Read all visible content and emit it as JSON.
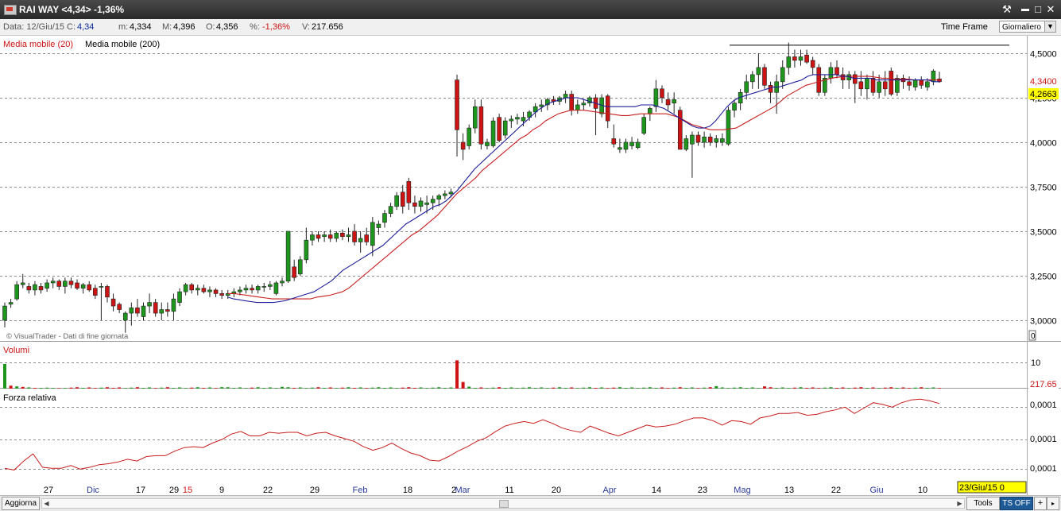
{
  "window": {
    "title": "RAI WAY <4,34> -1,36%",
    "buttons": {
      "tool": "⚒",
      "minimize": "▬",
      "maximize": "□",
      "close": "✕"
    }
  },
  "infobar": {
    "data": "Data: 12/Giu/15",
    "close_label": "C:",
    "close_value": "4,34",
    "min_label": "m:",
    "min_value": "4,334",
    "max_label": "M:",
    "max_value": "4,396",
    "open_label": "O:",
    "open_value": "4,356",
    "pct_label": "%:",
    "pct_value": "-1,36%",
    "vol_label": "V:",
    "vol_value": "217.656",
    "timeframe_label": "Time Frame",
    "timeframe_value": "Giornaliero"
  },
  "legend": {
    "ma20": "Media mobile (20)",
    "ma200": "Media mobile (200)",
    "watermark": "© VisualTrader - Dati di fine giornata",
    "volumes": "Volumi",
    "rsi": "Forza relativa"
  },
  "right_labels": {
    "last_price": "4,3400",
    "ma_price": "4,2663",
    "main_zero": "0",
    "volume_tick": "10",
    "volume_last": "217.65",
    "rsi_ticks": [
      "0,0001",
      "0,0001",
      "0,0001"
    ]
  },
  "date_box": "23/Giu/15 0",
  "bottombar": {
    "aggiorna": "Aggiorna",
    "tools": "Tools",
    "tsoff": "TS OFF",
    "plus": "+",
    "more": "▸"
  },
  "colors": {
    "up": "#1e961e",
    "down": "#cc1414",
    "ma20": "#c81e1e",
    "ma200": "#1e1e9b",
    "rsi": "#c81e1e",
    "grid": "#8c8c8c",
    "price_box": "#ffff00"
  },
  "chart_data": {
    "type": "candlestick",
    "price_axis": {
      "ticks": [
        "3,0000",
        "3,2500",
        "3,5000",
        "3,7500",
        "4,0000",
        "4,2500",
        "4,5000"
      ],
      "values": [
        3.0,
        3.25,
        3.5,
        3.75,
        4.0,
        4.25,
        4.5
      ],
      "range": [
        2.88,
        4.55
      ]
    },
    "x_axis_labels": [
      "27",
      "Dic",
      "17",
      "29",
      "15",
      "9",
      "22",
      "29",
      "Feb",
      "18",
      "2",
      "Mar",
      "11",
      "20",
      "Apr",
      "14",
      "23",
      "Mag",
      "13",
      "22",
      "Giu",
      "10"
    ],
    "resistance_level": 4.545,
    "ohlc": [
      [
        3.0,
        3.1,
        2.96,
        3.08
      ],
      [
        3.09,
        3.12,
        3.07,
        3.1
      ],
      [
        3.12,
        3.22,
        3.11,
        3.2
      ],
      [
        3.2,
        3.26,
        3.18,
        3.21
      ],
      [
        3.19,
        3.21,
        3.15,
        3.17
      ],
      [
        3.17,
        3.22,
        3.14,
        3.2
      ],
      [
        3.19,
        3.21,
        3.15,
        3.17
      ],
      [
        3.18,
        3.23,
        3.16,
        3.21
      ],
      [
        3.21,
        3.24,
        3.18,
        3.22
      ],
      [
        3.22,
        3.23,
        3.17,
        3.19
      ],
      [
        3.19,
        3.24,
        3.15,
        3.22
      ],
      [
        3.22,
        3.24,
        3.18,
        3.2
      ],
      [
        3.21,
        3.23,
        3.17,
        3.18
      ],
      [
        3.18,
        3.21,
        3.15,
        3.2
      ],
      [
        3.2,
        3.22,
        3.16,
        3.17
      ],
      [
        3.18,
        3.2,
        3.12,
        3.14
      ],
      [
        3.19,
        3.21,
        3.0,
        3.19
      ],
      [
        3.19,
        3.2,
        3.1,
        3.13
      ],
      [
        3.12,
        3.15,
        3.05,
        3.08
      ],
      [
        3.09,
        3.1,
        3.04,
        3.06
      ],
      [
        3.0,
        3.05,
        2.93,
        3.04
      ],
      [
        3.04,
        3.1,
        2.97,
        3.07
      ],
      [
        3.07,
        3.12,
        3.02,
        3.04
      ],
      [
        3.02,
        3.1,
        3.0,
        3.08
      ],
      [
        3.08,
        3.15,
        3.04,
        3.1
      ],
      [
        3.1,
        3.12,
        3.02,
        3.04
      ],
      [
        3.04,
        3.1,
        3.0,
        3.06
      ],
      [
        3.06,
        3.1,
        3.02,
        3.05
      ],
      [
        3.05,
        3.15,
        3.0,
        3.12
      ],
      [
        3.1,
        3.18,
        3.08,
        3.16
      ],
      [
        3.16,
        3.21,
        3.14,
        3.2
      ],
      [
        3.2,
        3.21,
        3.15,
        3.17
      ],
      [
        3.17,
        3.2,
        3.14,
        3.18
      ],
      [
        3.18,
        3.2,
        3.15,
        3.16
      ],
      [
        3.16,
        3.19,
        3.13,
        3.17
      ],
      [
        3.17,
        3.18,
        3.13,
        3.15
      ],
      [
        3.15,
        3.17,
        3.12,
        3.14
      ],
      [
        3.14,
        3.17,
        3.12,
        3.15
      ],
      [
        3.15,
        3.18,
        3.13,
        3.16
      ],
      [
        3.16,
        3.19,
        3.14,
        3.17
      ],
      [
        3.17,
        3.2,
        3.15,
        3.18
      ],
      [
        3.18,
        3.2,
        3.15,
        3.17
      ],
      [
        3.17,
        3.2,
        3.15,
        3.19
      ],
      [
        3.19,
        3.21,
        3.16,
        3.19
      ],
      [
        3.19,
        3.22,
        3.17,
        3.2
      ],
      [
        3.15,
        3.22,
        3.14,
        3.21
      ],
      [
        3.21,
        3.24,
        3.19,
        3.22
      ],
      [
        3.22,
        3.5,
        3.21,
        3.5
      ],
      [
        3.3,
        3.34,
        3.22,
        3.24
      ],
      [
        3.26,
        3.36,
        3.25,
        3.34
      ],
      [
        3.34,
        3.52,
        3.32,
        3.45
      ],
      [
        3.45,
        3.5,
        3.42,
        3.48
      ],
      [
        3.48,
        3.5,
        3.44,
        3.46
      ],
      [
        3.47,
        3.5,
        3.44,
        3.48
      ],
      [
        3.48,
        3.51,
        3.44,
        3.46
      ],
      [
        3.46,
        3.5,
        3.44,
        3.49
      ],
      [
        3.49,
        3.51,
        3.45,
        3.47
      ],
      [
        3.47,
        3.52,
        3.44,
        3.48
      ],
      [
        3.5,
        3.54,
        3.42,
        3.44
      ],
      [
        3.44,
        3.5,
        3.38,
        3.46
      ],
      [
        3.48,
        3.52,
        3.42,
        3.44
      ],
      [
        3.42,
        3.58,
        3.36,
        3.55
      ],
      [
        3.52,
        3.56,
        3.48,
        3.54
      ],
      [
        3.55,
        3.62,
        3.52,
        3.6
      ],
      [
        3.6,
        3.66,
        3.58,
        3.64
      ],
      [
        3.64,
        3.72,
        3.62,
        3.7
      ],
      [
        3.72,
        3.76,
        3.6,
        3.64
      ],
      [
        3.78,
        3.8,
        3.62,
        3.66
      ],
      [
        3.66,
        3.7,
        3.6,
        3.64
      ],
      [
        3.64,
        3.69,
        3.61,
        3.67
      ],
      [
        3.65,
        3.7,
        3.6,
        3.66
      ],
      [
        3.66,
        3.7,
        3.62,
        3.68
      ],
      [
        3.68,
        3.71,
        3.64,
        3.7
      ],
      [
        3.7,
        3.73,
        3.68,
        3.71
      ],
      [
        3.71,
        3.74,
        3.69,
        3.72
      ],
      [
        4.35,
        4.38,
        3.92,
        4.07
      ],
      [
        4.0,
        4.05,
        3.9,
        3.96
      ],
      [
        3.98,
        4.1,
        3.96,
        4.08
      ],
      [
        4.08,
        4.24,
        4.05,
        4.2
      ],
      [
        4.2,
        4.24,
        3.96,
        3.99
      ],
      [
        3.98,
        4.02,
        3.96,
        4.0
      ],
      [
        3.98,
        4.14,
        3.97,
        4.12
      ],
      [
        4.14,
        4.16,
        4.0,
        4.01
      ],
      [
        4.04,
        4.14,
        4.02,
        4.12
      ],
      [
        4.12,
        4.15,
        4.08,
        4.13
      ],
      [
        4.13,
        4.16,
        4.1,
        4.14
      ],
      [
        4.12,
        4.17,
        4.09,
        4.14
      ],
      [
        4.14,
        4.18,
        4.12,
        4.17
      ],
      [
        4.17,
        4.22,
        4.14,
        4.2
      ],
      [
        4.2,
        4.24,
        4.17,
        4.21
      ],
      [
        4.21,
        4.25,
        4.18,
        4.24
      ],
      [
        4.24,
        4.26,
        4.21,
        4.23
      ],
      [
        4.23,
        4.26,
        4.21,
        4.25
      ],
      [
        4.25,
        4.29,
        4.22,
        4.27
      ],
      [
        4.27,
        4.29,
        4.15,
        4.18
      ],
      [
        4.18,
        4.24,
        4.16,
        4.21
      ],
      [
        4.21,
        4.24,
        4.18,
        4.22
      ],
      [
        4.22,
        4.26,
        4.2,
        4.25
      ],
      [
        4.25,
        4.27,
        4.04,
        4.19
      ],
      [
        4.16,
        4.27,
        4.14,
        4.25
      ],
      [
        4.26,
        4.27,
        4.08,
        4.12
      ],
      [
        4.02,
        4.1,
        3.97,
        3.99
      ],
      [
        3.96,
        4.02,
        3.94,
        3.97
      ],
      [
        3.96,
        4.02,
        3.94,
        4.0
      ],
      [
        3.98,
        4.03,
        3.96,
        4.0
      ],
      [
        3.97,
        4.02,
        3.96,
        4.0
      ],
      [
        4.05,
        4.16,
        4.04,
        4.14
      ],
      [
        4.16,
        4.2,
        4.12,
        4.19
      ],
      [
        4.2,
        4.35,
        4.17,
        4.3
      ],
      [
        4.3,
        4.32,
        4.22,
        4.25
      ],
      [
        4.24,
        4.28,
        4.18,
        4.21
      ],
      [
        4.22,
        4.28,
        4.16,
        4.24
      ],
      [
        4.18,
        4.2,
        3.98,
        3.96
      ],
      [
        3.96,
        4.04,
        3.95,
        4.02
      ],
      [
        3.99,
        4.06,
        3.8,
        4.04
      ],
      [
        4.04,
        4.06,
        3.98,
        4.0
      ],
      [
        4.0,
        4.06,
        3.97,
        4.03
      ],
      [
        4.03,
        4.05,
        3.98,
        4.0
      ],
      [
        4.0,
        4.04,
        3.97,
        4.02
      ],
      [
        4.0,
        4.05,
        3.98,
        4.02
      ],
      [
        3.99,
        4.2,
        3.98,
        4.18
      ],
      [
        4.18,
        4.24,
        4.14,
        4.22
      ],
      [
        4.22,
        4.3,
        4.18,
        4.28
      ],
      [
        4.28,
        4.38,
        4.24,
        4.34
      ],
      [
        4.34,
        4.4,
        4.3,
        4.38
      ],
      [
        4.38,
        4.5,
        4.3,
        4.42
      ],
      [
        4.42,
        4.44,
        4.3,
        4.32
      ],
      [
        4.32,
        4.34,
        4.22,
        4.28
      ],
      [
        4.28,
        4.38,
        4.16,
        4.34
      ],
      [
        4.34,
        4.46,
        4.3,
        4.42
      ],
      [
        4.42,
        4.56,
        4.38,
        4.48
      ],
      [
        4.48,
        4.52,
        4.42,
        4.46
      ],
      [
        4.46,
        4.52,
        4.43,
        4.48
      ],
      [
        4.49,
        4.52,
        4.44,
        4.45
      ],
      [
        4.46,
        4.48,
        4.38,
        4.42
      ],
      [
        4.42,
        4.44,
        4.26,
        4.28
      ],
      [
        4.28,
        4.38,
        4.26,
        4.36
      ],
      [
        4.36,
        4.45,
        4.33,
        4.42
      ],
      [
        4.42,
        4.46,
        4.36,
        4.38
      ],
      [
        4.38,
        4.42,
        4.3,
        4.35
      ],
      [
        4.35,
        4.4,
        4.3,
        4.38
      ],
      [
        4.38,
        4.4,
        4.22,
        4.33
      ],
      [
        4.34,
        4.4,
        4.26,
        4.3
      ],
      [
        4.3,
        4.38,
        4.24,
        4.36
      ],
      [
        4.36,
        4.4,
        4.26,
        4.28
      ],
      [
        4.28,
        4.38,
        4.25,
        4.34
      ],
      [
        4.34,
        4.4,
        4.26,
        4.3
      ],
      [
        4.4,
        4.42,
        4.26,
        4.27
      ],
      [
        4.28,
        4.38,
        4.26,
        4.36
      ],
      [
        4.36,
        4.38,
        4.3,
        4.34
      ],
      [
        4.34,
        4.37,
        4.29,
        4.32
      ],
      [
        4.31,
        4.36,
        4.29,
        4.35
      ],
      [
        4.35,
        4.37,
        4.3,
        4.32
      ],
      [
        4.31,
        4.36,
        4.29,
        4.34
      ],
      [
        4.34,
        4.41,
        4.32,
        4.4
      ],
      [
        4.356,
        4.396,
        4.334,
        4.34
      ]
    ],
    "ma20": [
      3.15,
      3.15,
      3.145,
      3.14,
      3.135,
      3.13,
      3.125,
      3.12,
      3.12,
      3.12,
      3.12,
      3.12,
      3.12,
      3.12,
      3.13,
      3.135,
      3.14,
      3.15,
      3.16,
      3.18,
      3.21,
      3.24,
      3.27,
      3.3,
      3.33,
      3.36,
      3.39,
      3.42,
      3.45,
      3.48,
      3.5,
      3.53,
      3.56,
      3.59,
      3.63,
      3.67,
      3.71,
      3.74,
      3.77,
      3.8,
      3.84,
      3.87,
      3.9,
      3.93,
      3.96,
      3.99,
      4.02,
      4.04,
      4.07,
      4.09,
      4.12,
      4.14,
      4.16,
      4.17,
      4.18,
      4.18,
      4.18,
      4.175,
      4.17,
      4.165,
      4.16,
      4.155,
      4.15,
      4.15,
      4.155,
      4.16,
      4.16,
      4.16,
      4.16,
      4.16,
      4.15,
      4.14,
      4.12,
      4.1,
      4.09,
      4.08,
      4.07,
      4.07,
      4.07,
      4.075,
      4.08,
      4.1,
      4.12,
      4.14,
      4.16,
      4.18,
      4.2,
      4.23,
      4.26,
      4.28,
      4.3,
      4.32,
      4.33,
      4.34,
      4.35,
      4.36,
      4.365,
      4.37,
      4.37,
      4.37,
      4.37,
      4.37,
      4.365,
      4.36,
      4.36,
      4.355,
      4.355,
      4.355,
      4.35,
      4.35,
      4.35,
      4.35,
      4.35
    ],
    "ma20_start_index": 37,
    "ma200": [
      3.13,
      3.12,
      3.115,
      3.11,
      3.105,
      3.1,
      3.1,
      3.1,
      3.1,
      3.105,
      3.11,
      3.12,
      3.13,
      3.14,
      3.15,
      3.16,
      3.18,
      3.2,
      3.22,
      3.25,
      3.28,
      3.3,
      3.32,
      3.34,
      3.36,
      3.38,
      3.4,
      3.42,
      3.45,
      3.48,
      3.51,
      3.54,
      3.56,
      3.58,
      3.6,
      3.62,
      3.64,
      3.65,
      3.67,
      3.7,
      3.73,
      3.77,
      3.81,
      3.85,
      3.88,
      3.91,
      3.94,
      3.97,
      4.0,
      4.03,
      4.06,
      4.09,
      4.12,
      4.15,
      4.18,
      4.2,
      4.22,
      4.23,
      4.24,
      4.25,
      4.25,
      4.25,
      4.24,
      4.23,
      4.22,
      4.21,
      4.2,
      4.2,
      4.2,
      4.2,
      4.2,
      4.2,
      4.21,
      4.21,
      4.21,
      4.2,
      4.19,
      4.17,
      4.15,
      4.13,
      4.11,
      4.09,
      4.08,
      4.08,
      4.09,
      4.12,
      4.16,
      4.2,
      4.23,
      4.25,
      4.26,
      4.27,
      4.28,
      4.29,
      4.3,
      4.31,
      4.31,
      4.32,
      4.33,
      4.34,
      4.35,
      4.37,
      4.38,
      4.38,
      4.38,
      4.38,
      4.38,
      4.37,
      4.37,
      4.36,
      4.36,
      4.36,
      4.36,
      4.35,
      4.35,
      4.35,
      4.35,
      4.35,
      4.35,
      4.35,
      4.35,
      4.35,
      4.35,
      4.34,
      4.34
    ],
    "ma200_start_index": 37,
    "volume": [
      {
        "v": 10,
        "up": true
      },
      {
        "v": 1.2,
        "up": false
      },
      {
        "v": 0.9,
        "up": true
      },
      {
        "v": 0.7,
        "up": false
      },
      {
        "v": 0.5,
        "up": true
      },
      {
        "v": 0.3,
        "up": false
      },
      {
        "v": 0.3,
        "up": true
      },
      {
        "v": 0.4,
        "up": true
      },
      {
        "v": 0.3,
        "up": true
      },
      {
        "v": 0.2,
        "up": false
      }
    ],
    "volume_spikes": [
      {
        "index": 75,
        "v": 11.5,
        "up": false
      },
      {
        "index": 76,
        "v": 2.7,
        "up": false
      },
      {
        "index": 77,
        "v": 0.8,
        "up": true
      },
      {
        "index": 46,
        "v": 0.7,
        "up": true
      },
      {
        "index": 36,
        "v": 0.6,
        "up": true
      },
      {
        "index": 118,
        "v": 1.0,
        "up": true
      },
      {
        "index": 126,
        "v": 0.9,
        "up": false
      }
    ],
    "rsi": [
      0.86,
      0.88,
      0.78,
      0.7,
      0.85,
      0.86,
      0.86,
      0.83,
      0.87,
      0.85,
      0.82,
      0.81,
      0.79,
      0.76,
      0.78,
      0.73,
      0.72,
      0.72,
      0.67,
      0.63,
      0.62,
      0.63,
      0.58,
      0.54,
      0.48,
      0.45,
      0.5,
      0.5,
      0.46,
      0.47,
      0.46,
      0.46,
      0.5,
      0.47,
      0.46,
      0.5,
      0.53,
      0.56,
      0.62,
      0.66,
      0.63,
      0.58,
      0.64,
      0.69,
      0.72,
      0.77,
      0.78,
      0.73,
      0.67,
      0.62,
      0.56,
      0.52,
      0.45,
      0.39,
      0.36,
      0.34,
      0.36,
      0.32,
      0.36,
      0.41,
      0.44,
      0.46,
      0.39,
      0.43,
      0.47,
      0.5,
      0.46,
      0.42,
      0.38,
      0.4,
      0.39,
      0.37,
      0.33,
      0.3,
      0.3,
      0.33,
      0.38,
      0.33,
      0.34,
      0.37,
      0.3,
      0.28,
      0.25,
      0.25,
      0.24,
      0.27,
      0.26,
      0.23,
      0.21,
      0.18,
      0.25,
      0.19,
      0.13,
      0.15,
      0.18,
      0.13,
      0.1,
      0.09,
      0.11,
      0.14
    ]
  }
}
